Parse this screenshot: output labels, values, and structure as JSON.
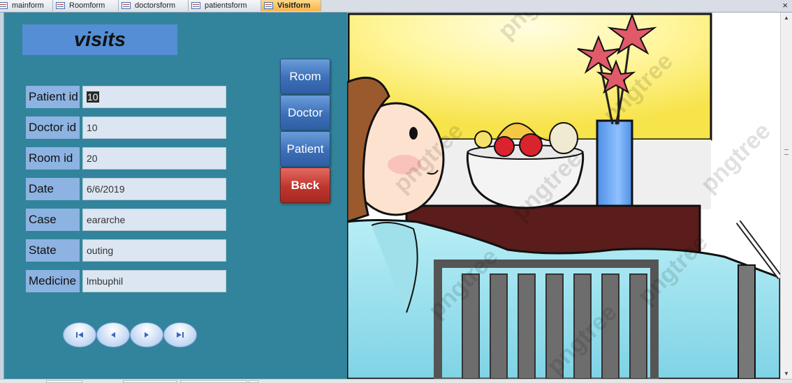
{
  "tabs": [
    {
      "label": "mainform",
      "active": false
    },
    {
      "label": "Roomform",
      "active": false
    },
    {
      "label": "doctorsform",
      "active": false
    },
    {
      "label": "patientsform",
      "active": false
    },
    {
      "label": "Visitform",
      "active": true
    }
  ],
  "close_glyph": "×",
  "form": {
    "title": "visits",
    "fields": [
      {
        "label": "Patient id",
        "value": "10"
      },
      {
        "label": "Doctor id",
        "value": "10"
      },
      {
        "label": "Room id",
        "value": "20"
      },
      {
        "label": "Date",
        "value": "6/6/2019"
      },
      {
        "label": "Case",
        "value": "eararche"
      },
      {
        "label": "State",
        "value": "outing"
      },
      {
        "label": "Medicine",
        "value": "lmbuphil"
      }
    ]
  },
  "buttons": {
    "room": "Room",
    "doctor": "Doctor",
    "patient": "Patient",
    "back": "Back"
  },
  "record_nav": [
    {
      "name": "first-record-icon"
    },
    {
      "name": "previous-record-icon"
    },
    {
      "name": "next-record-icon"
    },
    {
      "name": "last-record-icon"
    }
  ],
  "colors": {
    "form_background": "#31849b",
    "title_background": "#558ed5",
    "label_background": "#8db3e2",
    "field_background": "#dce6f2",
    "button_blue": "#3c6fb8",
    "button_red": "#c0352d",
    "active_tab": "#f7b54a"
  },
  "picture": {
    "watermark": "pngtree"
  }
}
